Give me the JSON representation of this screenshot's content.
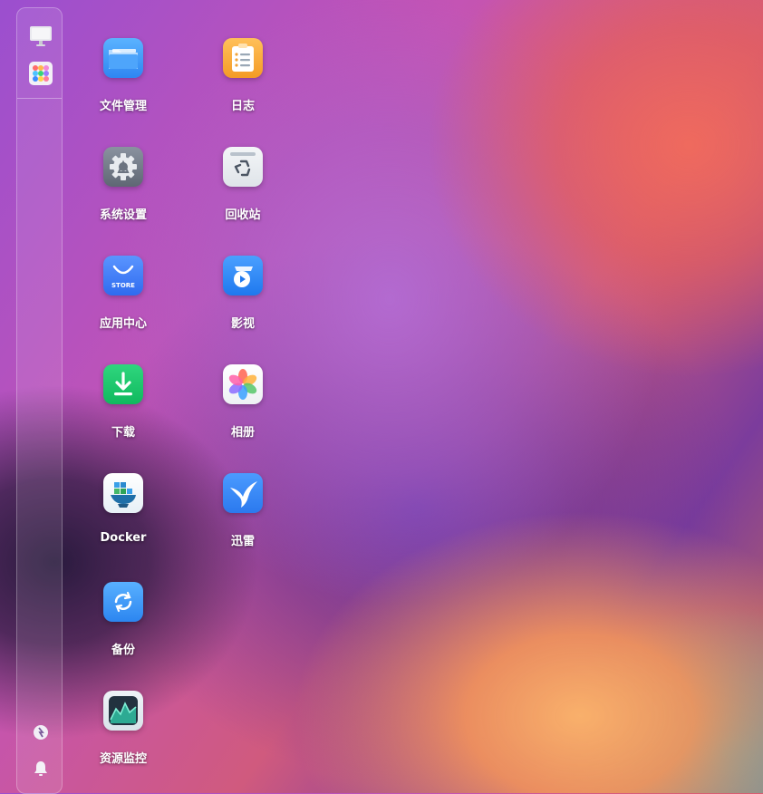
{
  "sidebar": {
    "items": [
      {
        "name": "desktop-icon"
      },
      {
        "name": "app-grid-icon"
      },
      {
        "name": "switch-icon"
      },
      {
        "name": "bell-icon"
      }
    ]
  },
  "apps": [
    {
      "label": "文件管理",
      "icon": "folder-icon"
    },
    {
      "label": "日志",
      "icon": "log-icon"
    },
    {
      "label": "系统设置",
      "icon": "gear-icon"
    },
    {
      "label": "回收站",
      "icon": "recycle-bin-icon"
    },
    {
      "label": "应用中心",
      "icon": "store-icon",
      "icon_text": "STORE"
    },
    {
      "label": "影视",
      "icon": "video-icon"
    },
    {
      "label": "下载",
      "icon": "download-icon"
    },
    {
      "label": "相册",
      "icon": "photos-icon"
    },
    {
      "label": "Docker",
      "icon": "docker-icon"
    },
    {
      "label": "迅雷",
      "icon": "thunder-icon"
    },
    {
      "label": "备份",
      "icon": "backup-icon"
    },
    {
      "label": "资源监控",
      "icon": "monitor-icon"
    }
  ],
  "colors": {
    "folder": "#3f9cf5",
    "log": "#f6a93b",
    "settings": "#6f7784",
    "store": "#3d7bf3",
    "video": "#2f86f6",
    "download": "#17c669",
    "thunder": "#2e86f2",
    "backup": "#2c8cf4",
    "monitor": "#2a3a4a"
  }
}
